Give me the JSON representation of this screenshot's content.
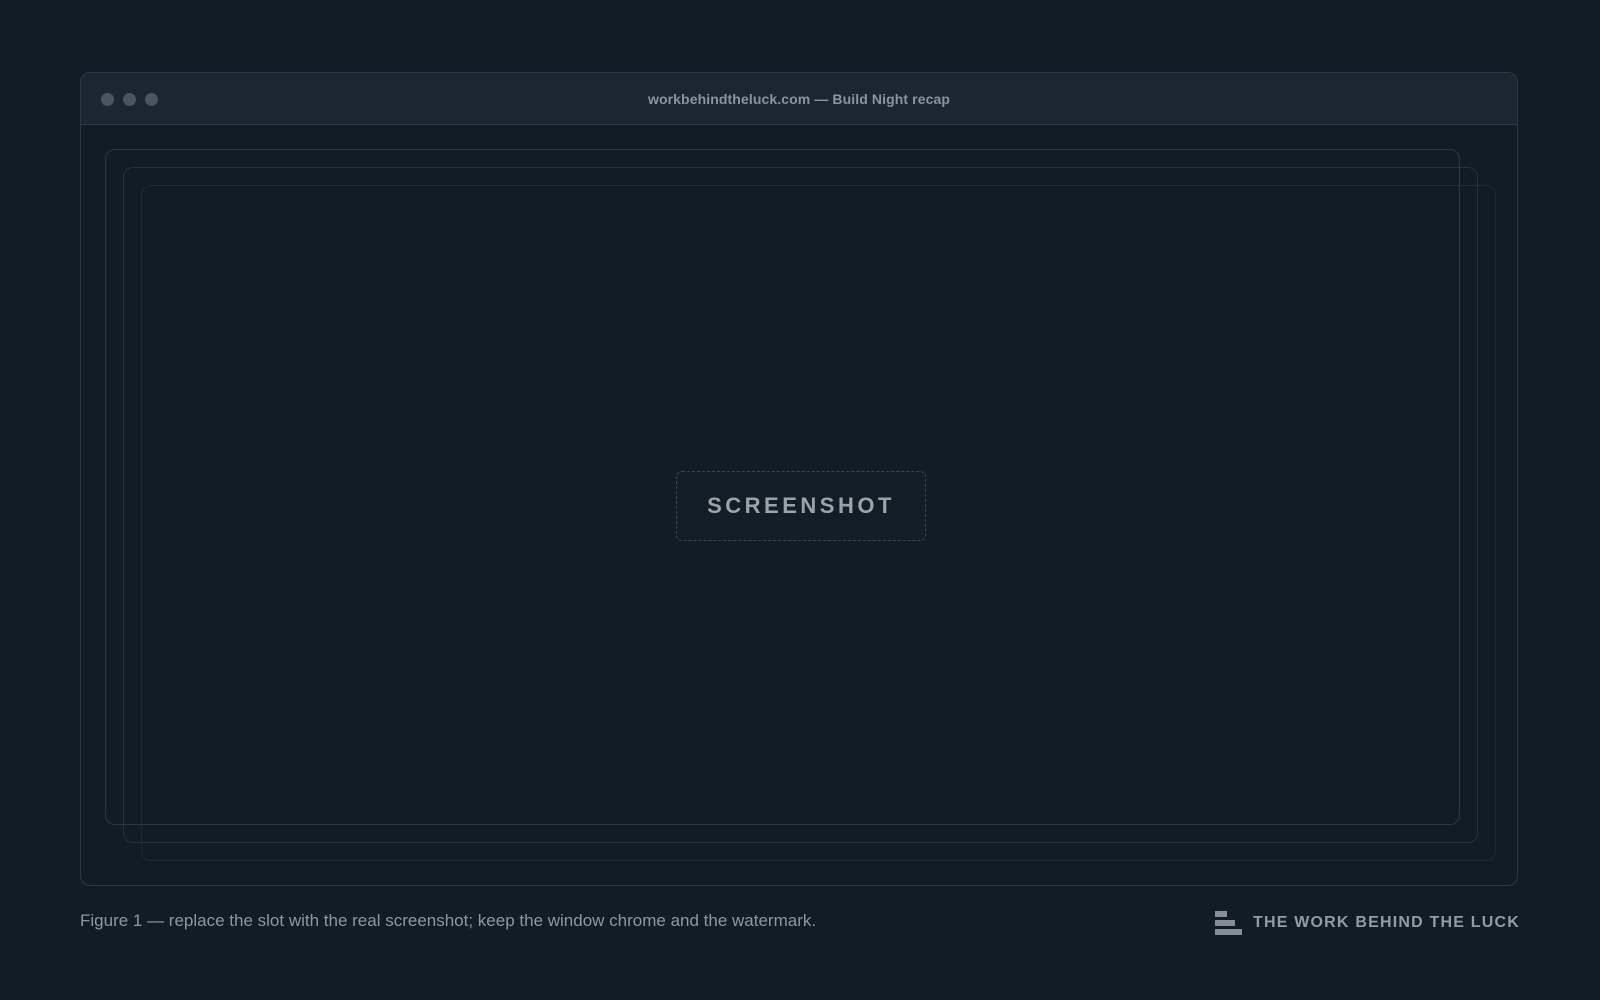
{
  "window": {
    "title": "workbehindtheluck.com — Build Night recap"
  },
  "slot": {
    "label": "SCREENSHOT"
  },
  "caption": {
    "text": "Figure 1 — replace the slot with the real screenshot; keep the window chrome and the watermark."
  },
  "watermark": {
    "text": "THE WORK BEHIND THE LUCK",
    "icon": "bars-logo-icon"
  },
  "colors": {
    "background": "#111c24",
    "titlebar": "#1a2632",
    "text_muted": "#8d979f"
  }
}
